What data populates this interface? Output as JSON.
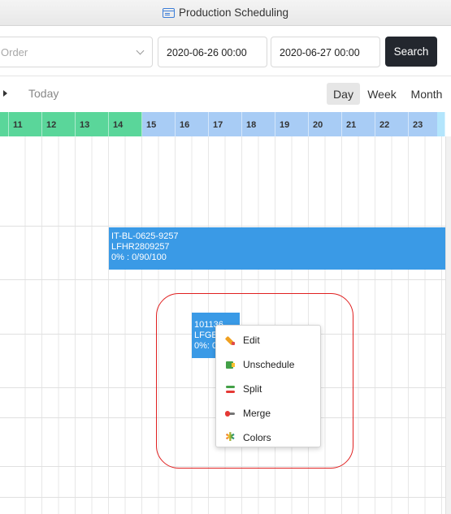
{
  "window": {
    "title": "Production Scheduling",
    "icon": "window-icon"
  },
  "filters": {
    "order_placeholder": "Order",
    "start_date": "2020-06-26 00:00",
    "end_date": "2020-06-27 00:00",
    "search_label": "Search"
  },
  "toolbar": {
    "next_icon": "triangle-right",
    "today_label": "Today",
    "views": {
      "day": "Day",
      "week": "Week",
      "month": "Month"
    },
    "active_view": "Day"
  },
  "timeline": {
    "hours": [
      "11",
      "12",
      "13",
      "14",
      "15",
      "16",
      "17",
      "18",
      "19",
      "20",
      "21",
      "22",
      "23"
    ],
    "colors": {
      "past": "#5ad69a",
      "current": "#5ad69a",
      "future": "#a8ccf5",
      "overflow": "#b3e5fc"
    }
  },
  "tasks": [
    {
      "line1": "IT-BL-0625-9257",
      "line2": "LFHR2809257",
      "line3": "0% : 0/90/100"
    },
    {
      "line1": "101136",
      "line2": "LFGE",
      "line3": "0%: 0"
    }
  ],
  "context_menu": {
    "items": [
      {
        "label": "Edit",
        "icon": "edit-icon"
      },
      {
        "label": "Unschedule",
        "icon": "unschedule-icon"
      },
      {
        "label": "Split",
        "icon": "split-icon"
      },
      {
        "label": "Merge",
        "icon": "merge-icon"
      },
      {
        "label": "Colors",
        "icon": "colors-icon"
      }
    ]
  },
  "colors": {
    "task": "#3a9ae6",
    "highlight": "#e02020",
    "search_button": "#23272e"
  }
}
